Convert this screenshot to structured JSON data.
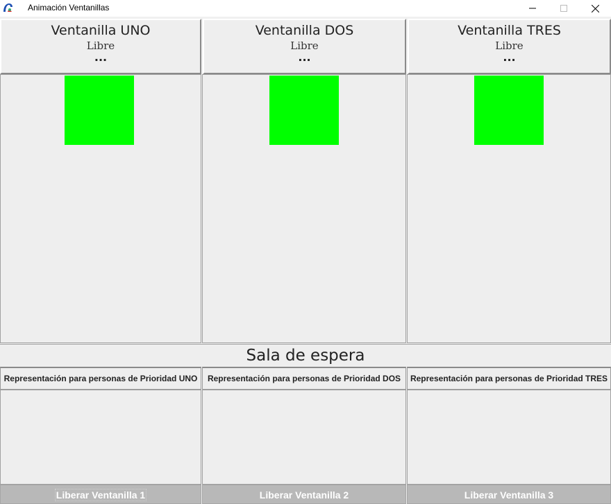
{
  "window": {
    "title": "Animación Ventanillas"
  },
  "ventanillas": [
    {
      "name": "Ventanilla UNO",
      "status": "Libre",
      "dots": "...",
      "indicator_color": "#00ff00"
    },
    {
      "name": "Ventanilla DOS",
      "status": "Libre",
      "dots": "...",
      "indicator_color": "#00ff00"
    },
    {
      "name": "Ventanilla TRES",
      "status": "Libre",
      "dots": "...",
      "indicator_color": "#00ff00"
    }
  ],
  "sala": {
    "title": "Sala de espera"
  },
  "prioridades": [
    {
      "label": "Representación para personas de Prioridad UNO"
    },
    {
      "label": "Representación para personas de Prioridad DOS"
    },
    {
      "label": "Representación para personas de Prioridad TRES"
    }
  ],
  "buttons": [
    {
      "label": "Liberar Ventanilla 1"
    },
    {
      "label": "Liberar Ventanilla 2"
    },
    {
      "label": "Liberar Ventanilla 3"
    }
  ]
}
